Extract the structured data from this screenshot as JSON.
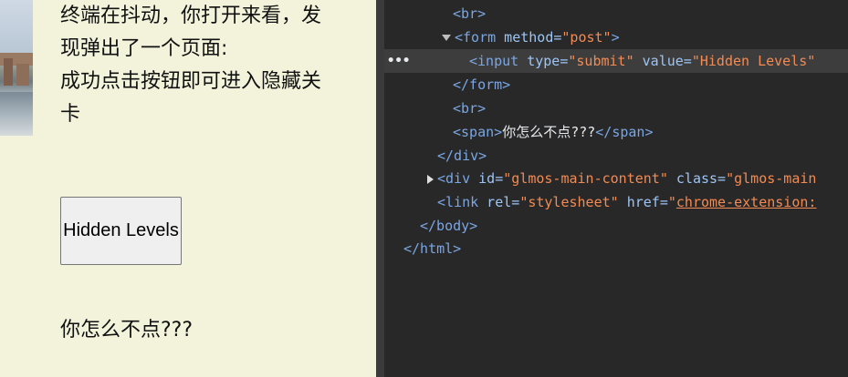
{
  "page": {
    "paragraph_lines": [
      "终端在抖动，你打开来看，发",
      "现弹出了一个页面:",
      "成功点击按钮即可进入隐藏关",
      "卡"
    ],
    "button_label": "Hidden Levels",
    "bottom_text": "你怎么不点???"
  },
  "devtools": {
    "row_menu": "•••",
    "lines": {
      "br1": {
        "open": "<br>"
      },
      "form_open": {
        "tag": "<form",
        "attr": " method=",
        "val": "\"post\"",
        "close": ">"
      },
      "input": {
        "tag": "<input",
        "attr1": " type=",
        "val1": "\"submit\"",
        "attr2": " value=",
        "val2": "\"Hidden Levels\""
      },
      "form_close": {
        "tag": "</form>"
      },
      "br2": {
        "tag": "<br>"
      },
      "span": {
        "open": "<span>",
        "text": "你怎么不点???",
        "close": "</span>"
      },
      "div_close": {
        "tag": "</div>"
      },
      "div_main": {
        "tag": "<div",
        "attr1": " id=",
        "val1": "\"glmos-main-content\"",
        "attr2": " class=",
        "val2": "\"glmos-main"
      },
      "link": {
        "tag": "<link",
        "attr1": " rel=",
        "val1": "\"stylesheet\"",
        "attr2": " href=",
        "val2_q": "\"",
        "val2": "chrome-extension:"
      },
      "body_close": {
        "tag": "</body>"
      },
      "html_close": {
        "tag": "</html>"
      }
    }
  }
}
